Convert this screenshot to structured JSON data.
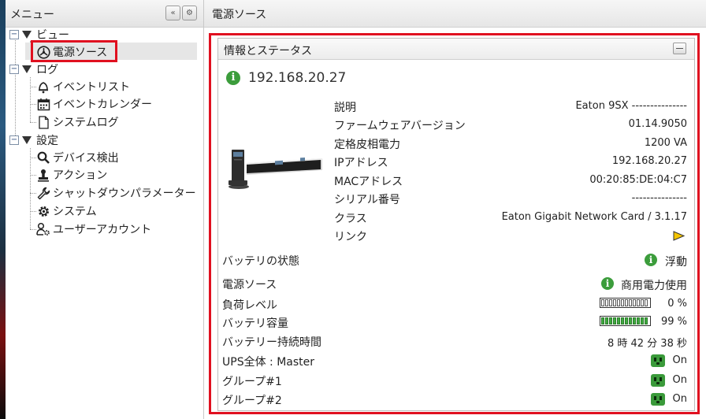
{
  "left_panel": {
    "title": "メニュー",
    "tree": {
      "view": {
        "label": "ビュー",
        "items": [
          {
            "label": "電源ソース",
            "icon": "power-source-icon"
          }
        ]
      },
      "log": {
        "label": "ログ",
        "items": [
          {
            "label": "イベントリスト",
            "icon": "bell-icon"
          },
          {
            "label": "イベントカレンダー",
            "icon": "calendar-icon"
          },
          {
            "label": "システムログ",
            "icon": "document-icon"
          }
        ]
      },
      "settings": {
        "label": "設定",
        "items": [
          {
            "label": "デバイス検出",
            "icon": "magnifier-icon"
          },
          {
            "label": "アクション",
            "icon": "stamp-icon"
          },
          {
            "label": "シャットダウンパラメーター",
            "icon": "wrench-icon"
          },
          {
            "label": "システム",
            "icon": "gear-icon"
          },
          {
            "label": "ユーザーアカウント",
            "icon": "user-gear-icon"
          }
        ]
      }
    }
  },
  "right_panel": {
    "title": "電源ソース",
    "section_title": "情報とステータス",
    "ip_heading": "192.168.20.27",
    "device_info": [
      {
        "label": "説明",
        "value": "Eaton 9SX ---------------"
      },
      {
        "label": "ファームウェアバージョン",
        "value": "01.14.9050"
      },
      {
        "label": "定格皮相電力",
        "value": "1200 VA"
      },
      {
        "label": "IPアドレス",
        "value": "192.168.20.27"
      },
      {
        "label": "MACアドレス",
        "value": "00:20:85:DE:04:C7"
      },
      {
        "label": "シリアル番号",
        "value": "---------------"
      },
      {
        "label": "クラス",
        "value": "Eaton Gigabit Network Card / 3.1.17"
      },
      {
        "label": "リンク",
        "value": ""
      }
    ],
    "status": {
      "battery_state": {
        "label": "バッテリの状態",
        "value": "浮動"
      },
      "power_source": {
        "label": "電源ソース",
        "value": "商用電力使用"
      },
      "load_level": {
        "label": "負荷レベル",
        "value": "0 %",
        "fraction": 0.0
      },
      "battery_capacity": {
        "label": "バッテリ容量",
        "value": "99 %",
        "fraction": 0.99
      },
      "battery_runtime": {
        "label": "バッテリー持続時間",
        "value": "8 時 42 分 38 秒"
      },
      "ups_master": {
        "label": "UPS全体 : Master",
        "value": "On"
      },
      "group1": {
        "label": "グループ#1",
        "value": "On"
      },
      "group2": {
        "label": "グループ#2",
        "value": "On"
      }
    }
  },
  "colors": {
    "highlight_border": "#e01020",
    "status_green": "#3c9d3c",
    "selected_row": "#e6e6e6"
  }
}
